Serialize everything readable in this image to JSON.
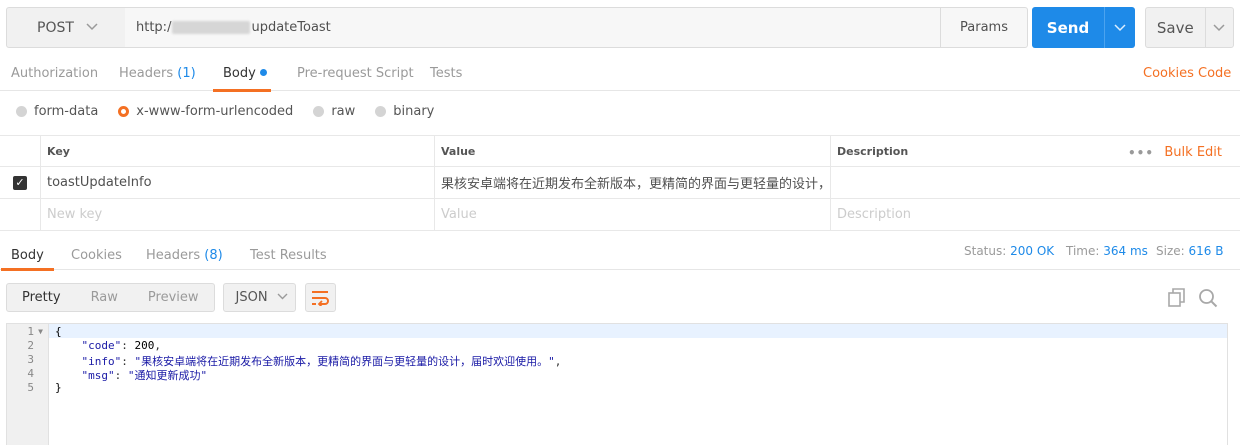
{
  "request": {
    "method": "POST",
    "url_prefix": "http:/",
    "url_suffix": "updateToast",
    "params_label": "Params",
    "send_label": "Send",
    "save_label": "Save"
  },
  "request_tabs": {
    "authorization": "Authorization",
    "headers": "Headers",
    "headers_count": "(1)",
    "body": "Body",
    "prerequest": "Pre-request Script",
    "tests": "Tests",
    "cookies_link": "Cookies",
    "code_link": "Code"
  },
  "body_types": {
    "form_data": "form-data",
    "urlencoded": "x-www-form-urlencoded",
    "raw": "raw",
    "binary": "binary"
  },
  "kv_table": {
    "headers": {
      "key": "Key",
      "value": "Value",
      "description": "Description"
    },
    "more": "•••",
    "bulk_edit": "Bulk Edit",
    "rows": [
      {
        "checked": true,
        "key": "toastUpdateInfo",
        "value": "果核安卓端将在近期发布全新版本，更精简的界面与更轻量的设计，...",
        "description": ""
      }
    ],
    "placeholder": {
      "key": "New key",
      "value": "Value",
      "description": "Description"
    }
  },
  "response_tabs": {
    "body": "Body",
    "cookies": "Cookies",
    "headers": "Headers",
    "headers_count": "(8)",
    "test_results": "Test Results",
    "status_label": "Status:",
    "status_value": "200 OK",
    "time_label": "Time:",
    "time_value": "364 ms",
    "size_label": "Size:",
    "size_value": "616 B"
  },
  "response_toolbar": {
    "pretty": "Pretty",
    "raw": "Raw",
    "preview": "Preview",
    "format": "JSON"
  },
  "response_body": {
    "line_numbers": [
      "1",
      "2",
      "3",
      "4",
      "5"
    ],
    "open_brace": "{",
    "close_brace": "}",
    "code_key": "\"code\"",
    "code_value": "200",
    "info_key": "\"info\"",
    "info_value": "\"果核安卓端将在近期发布全新版本，更精简的界面与更轻量的设计，届时欢迎使用。\"",
    "msg_key": "\"msg\"",
    "msg_value": "\"通知更新成功\""
  },
  "colors": {
    "accent": "#f47023",
    "primary": "#1e8ae8"
  }
}
